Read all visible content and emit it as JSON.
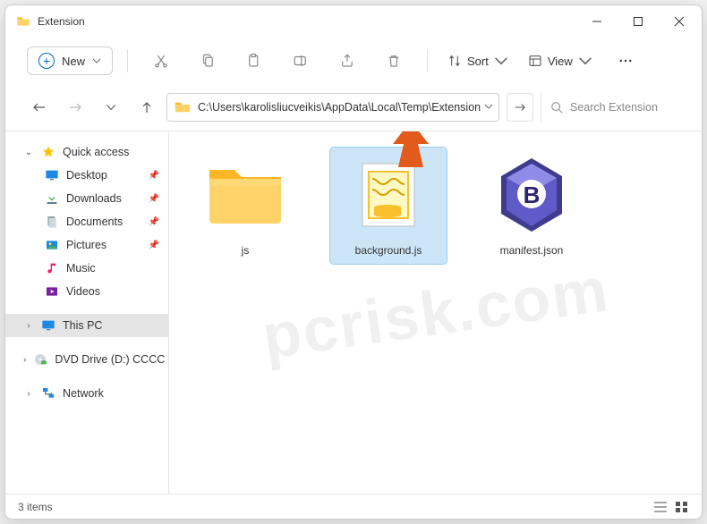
{
  "window": {
    "title": "Extension",
    "min_label": "Minimize",
    "max_label": "Maximize",
    "close_label": "Close"
  },
  "toolbar": {
    "new_label": "New",
    "sort_label": "Sort",
    "view_label": "View",
    "icons": [
      "cut",
      "copy",
      "paste",
      "rename",
      "share",
      "delete"
    ]
  },
  "address": {
    "path": "C:\\Users\\karolisliucveikis\\AppData\\Local\\Temp\\Extension"
  },
  "search": {
    "placeholder": "Search Extension"
  },
  "sidebar": {
    "quick_access": "Quick access",
    "items": [
      {
        "label": "Desktop",
        "pinned": true
      },
      {
        "label": "Downloads",
        "pinned": true
      },
      {
        "label": "Documents",
        "pinned": true
      },
      {
        "label": "Pictures",
        "pinned": true
      },
      {
        "label": "Music",
        "pinned": false
      },
      {
        "label": "Videos",
        "pinned": false
      }
    ],
    "this_pc": "This PC",
    "dvd": "DVD Drive (D:) CCCC",
    "network": "Network"
  },
  "files": [
    {
      "name": "js",
      "type": "folder",
      "selected": false
    },
    {
      "name": "background.js",
      "type": "jsfile",
      "selected": true
    },
    {
      "name": "manifest.json",
      "type": "jsonfile",
      "selected": false
    }
  ],
  "status": {
    "text": "3 items"
  },
  "watermark": "pcrisk.com"
}
